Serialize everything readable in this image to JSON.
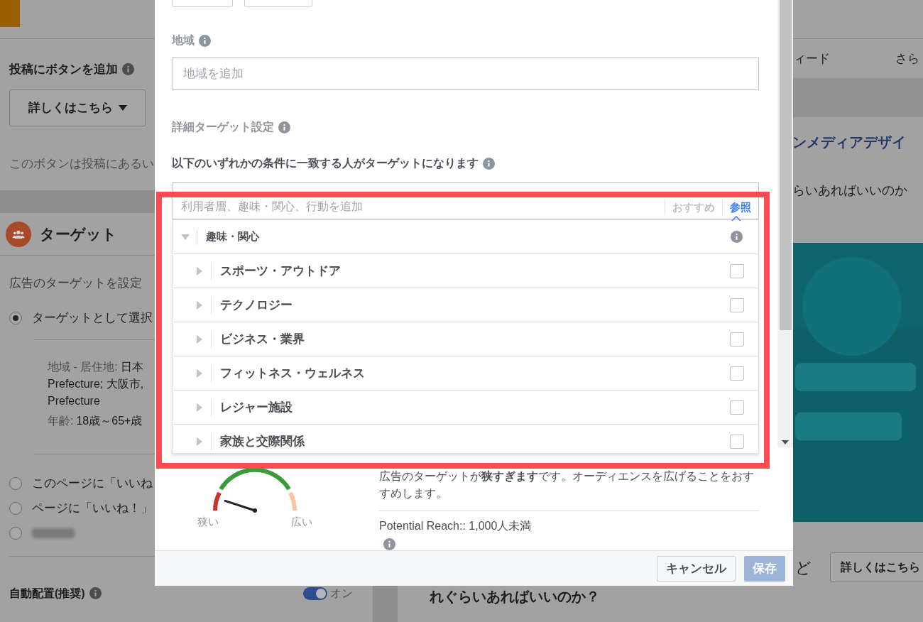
{
  "left_panel": {
    "top_strip": {
      "kind": "block"
    },
    "button_section": {
      "title": "投稿にボタンを追加",
      "button": "詳しくはこちら",
      "note": "このボタンは投稿にあるい"
    },
    "target": {
      "title": "ターゲット",
      "description": "広告のターゲットを設定",
      "options": [
        {
          "kind": "text",
          "label": "ターゲットとして選択",
          "selected": true,
          "details": [
            {
              "label": "地域 - 居住地:",
              "lines": [
                "日本",
                "Prefecture; 大阪市,",
                "Prefecture"
              ]
            },
            {
              "label": "年齢:",
              "lines": [
                "18歳～65+歳"
              ]
            }
          ]
        },
        {
          "kind": "text",
          "label": "このページに「いいね",
          "selected": false
        },
        {
          "kind": "text",
          "label": "ページに「いいね！」",
          "selected": false
        },
        {
          "kind": "blurred",
          "selected": false
        }
      ]
    },
    "auto_placement": {
      "label": "自動配置(推奨)",
      "toggle": {
        "on": true,
        "label": "オン"
      }
    }
  },
  "right_panel": {
    "tabs": [
      "ィード",
      "さら"
    ],
    "link_title": "ンメディアデザイ",
    "subtitle": "らいあればいいのか",
    "image": {
      "kind": "picture"
    },
    "caption": "ど",
    "button": "詳しくはこちら",
    "bottom_title": "れぐらいあればいいのか？"
  },
  "modal": {
    "location": {
      "label": "地域",
      "placeholder": "地域を追加"
    },
    "detailed_targeting": {
      "title": "詳細ターゲット設定",
      "subtitle": "以下のいずれかの条件に一致する人がターゲットになります",
      "search": {
        "placeholder": "利用者層、趣味・関心、行動を追加"
      },
      "tabs": [
        {
          "label": "おすすめ",
          "selected": false
        },
        {
          "label": "参照",
          "selected": true
        }
      ],
      "category": {
        "label": "趣味・関心",
        "expanded": true,
        "children": [
          {
            "label": "スポーツ・アウトドア",
            "expanded": false,
            "checked": false
          },
          {
            "label": "テクノロジー",
            "expanded": false,
            "checked": false
          },
          {
            "label": "ビジネス・業界",
            "expanded": false,
            "checked": false
          },
          {
            "label": "フィットネス・ウェルネス",
            "expanded": false,
            "checked": false
          },
          {
            "label": "レジャー施設",
            "expanded": false,
            "checked": false
          },
          {
            "label": "家族と交際関係",
            "expanded": false,
            "checked": false
          }
        ]
      }
    },
    "audience": {
      "gauge": {
        "level": 0.1,
        "low_label": "狭い",
        "high_label": "広い"
      },
      "message": "広告のターゲットが**狭すぎます**です。オーディエンスを広げることをおすすめします。",
      "reach": "Potential Reach:: 1,000人未満"
    },
    "buttons": [
      {
        "label": "キャンセル",
        "kind": "secondary",
        "disabled": false
      },
      {
        "label": "保存",
        "kind": "primary",
        "disabled": true
      }
    ]
  },
  "annotation": {
    "kind": "highlight",
    "color": "#ff4a4f"
  }
}
